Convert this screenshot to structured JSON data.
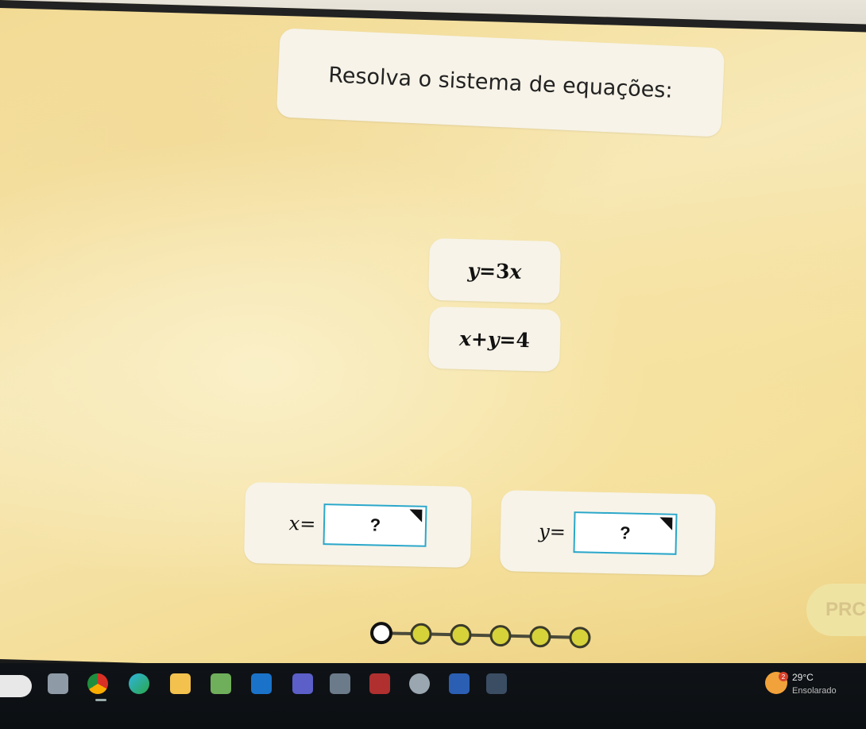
{
  "question": {
    "title": "Resolva o sistema de equações:"
  },
  "equations": [
    {
      "lhs": "y",
      "op": "=",
      "rhs_coef": "3",
      "rhs_var": "x"
    },
    {
      "lhs": "x+y",
      "op": "=",
      "rhs": "4"
    }
  ],
  "answers": {
    "x": {
      "label": "x",
      "eq": "=",
      "value": "?"
    },
    "y": {
      "label": "y",
      "eq": "=",
      "value": "?"
    }
  },
  "next_button": {
    "label": "PRC"
  },
  "progress": {
    "steps": 6,
    "current": 1
  },
  "taskbar": {
    "weather_badge": "2",
    "temperature": "29°C",
    "condition": "Ensolarado",
    "apps": [
      "window-icon",
      "chrome-icon",
      "edge-icon",
      "folder-icon",
      "puzzle-icon",
      "outlook-icon",
      "teams-icon",
      "media-icon",
      "access-icon",
      "browser-icon",
      "word-icon",
      "calculator-icon"
    ]
  },
  "colors": {
    "accent": "#2aa7c9",
    "progress_fill": "#d6d23a",
    "progress_current": "#ffffff",
    "background": "#f5e3a6"
  }
}
